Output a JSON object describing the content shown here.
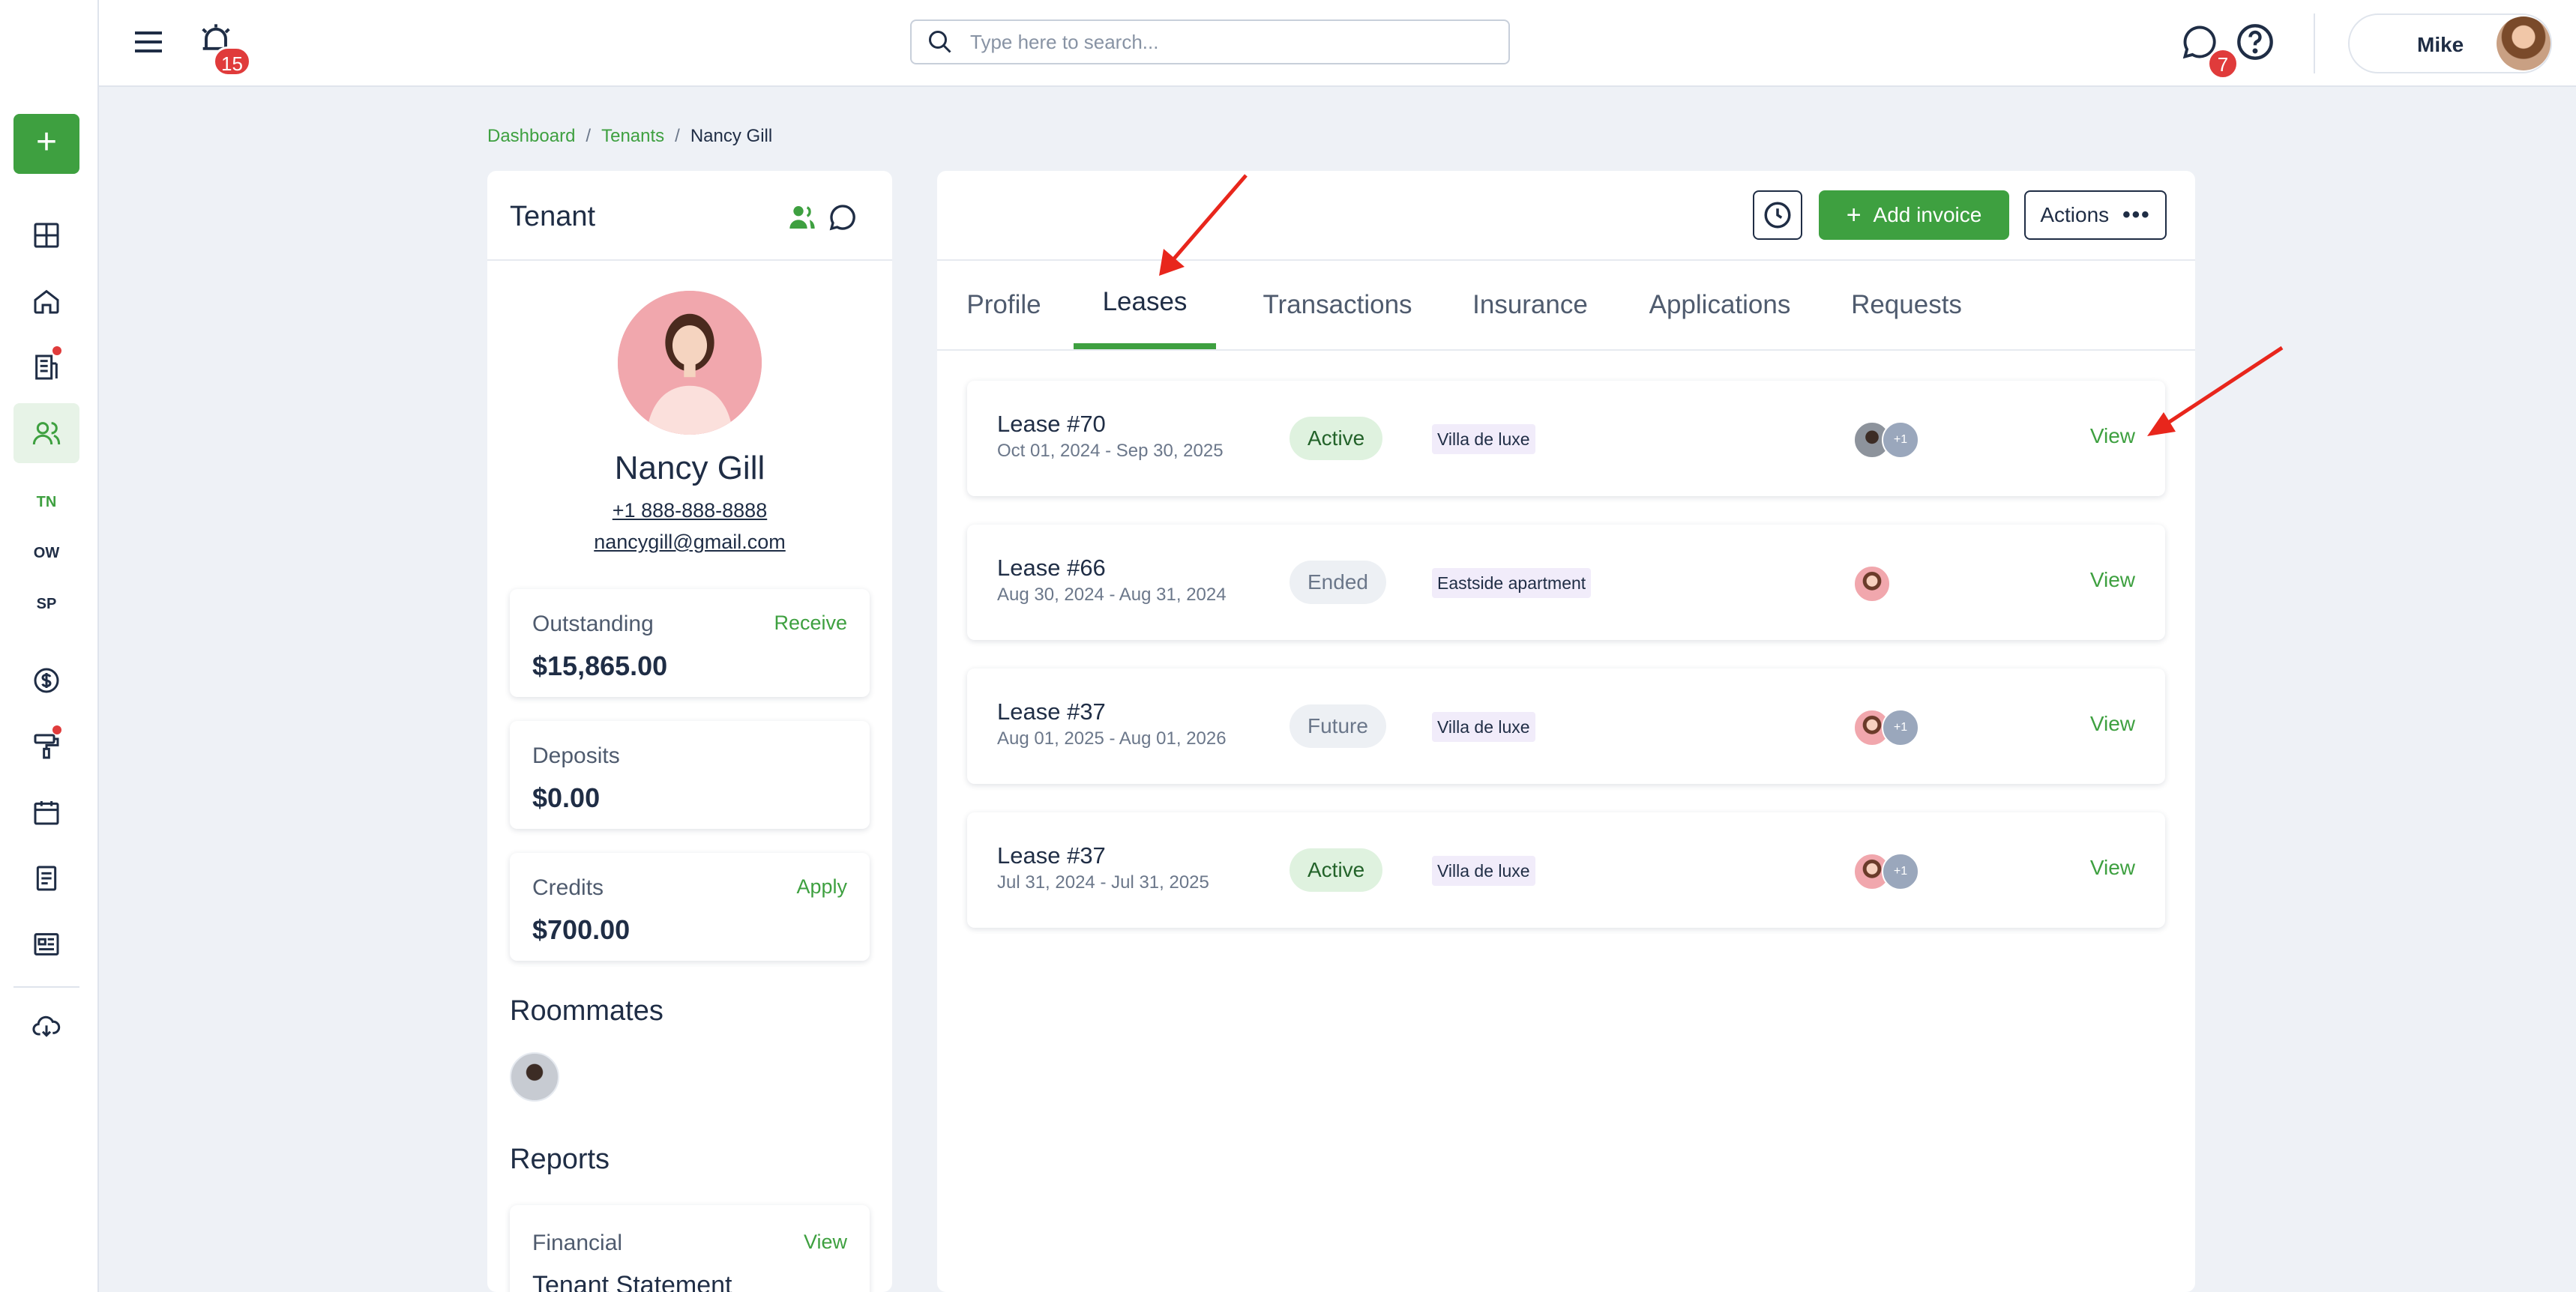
{
  "topbar": {
    "notification_count": "15",
    "search_placeholder": "Type here to search...",
    "messages_count": "7",
    "user_name": "Mike"
  },
  "sidebar": {
    "add_label": "+",
    "sub_items": [
      "TN",
      "OW",
      "SP"
    ]
  },
  "breadcrumb": {
    "items": [
      "Dashboard",
      "Tenants",
      "Nancy Gill"
    ],
    "separator": "/"
  },
  "tenant": {
    "header_title": "Tenant",
    "name": "Nancy Gill",
    "phone": "+1 888-888-8888",
    "email": "nancygill@gmail.com",
    "outstanding": {
      "label": "Outstanding",
      "value": "$15,865.00",
      "action": "Receive"
    },
    "deposits": {
      "label": "Deposits",
      "value": "$0.00"
    },
    "credits": {
      "label": "Credits",
      "value": "$700.00",
      "action": "Apply"
    },
    "roommates_title": "Roommates",
    "reports_title": "Reports",
    "report": {
      "label": "Financial",
      "action": "View",
      "name": "Tenant Statement"
    }
  },
  "main": {
    "add_invoice_label": "Add invoice",
    "actions_label": "Actions",
    "tabs": [
      "Profile",
      "Leases",
      "Transactions",
      "Insurance",
      "Applications",
      "Requests"
    ],
    "active_tab": "Leases",
    "leases": [
      {
        "title": "Lease #70",
        "dates": "Oct 01, 2024 - Sep 30, 2025",
        "status": "Active",
        "property": "Villa de luxe",
        "extra": "+1",
        "view": "View"
      },
      {
        "title": "Lease #66",
        "dates": "Aug 30, 2024 - Aug 31, 2024",
        "status": "Ended",
        "property": "Eastside apartment",
        "extra": "",
        "view": "View"
      },
      {
        "title": "Lease #37",
        "dates": "Aug 01, 2025 - Aug 01, 2026",
        "status": "Future",
        "property": "Villa de luxe",
        "extra": "+1",
        "view": "View"
      },
      {
        "title": "Lease #37",
        "dates": "Jul 31, 2024 - Jul 31, 2025",
        "status": "Active",
        "property": "Villa de luxe",
        "extra": "+1",
        "view": "View"
      }
    ]
  },
  "colors": {
    "brand_green": "#3ea040",
    "badge_red": "#e03b3b",
    "text_dark": "#1f2d45",
    "annotation_red": "#e8261c"
  }
}
